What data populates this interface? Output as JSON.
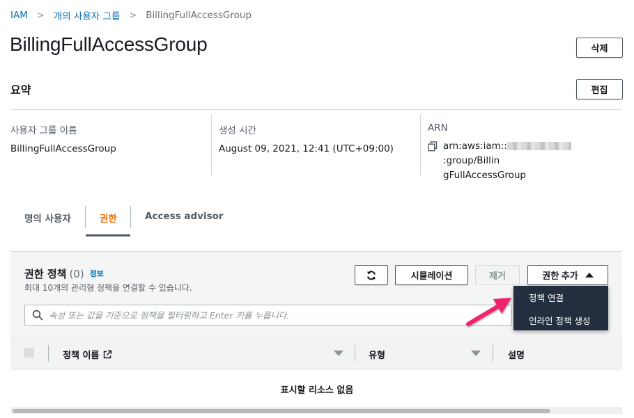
{
  "breadcrumb": {
    "root": "IAM",
    "parent": "개의 사용자 그룹",
    "current": "BillingFullAccessGroup"
  },
  "page": {
    "title": "BillingFullAccessGroup",
    "delete_label": "삭제"
  },
  "summary": {
    "title": "요약",
    "edit_label": "편집",
    "group_name_label": "사용자 그룹 이름",
    "group_name_value": "BillingFullAccessGroup",
    "created_label": "생성 시간",
    "created_value": "August 09, 2021, 12:41 (UTC+09:00)",
    "arn_label": "ARN",
    "arn_prefix": "arn:aws:iam::",
    "arn_suffix": ":group/Billin",
    "arn_line2": "gFullAccessGroup"
  },
  "tabs": [
    {
      "label": "명의 사용자"
    },
    {
      "label": "권한"
    },
    {
      "label": "Access advisor"
    }
  ],
  "permissions": {
    "title": "권한 정책",
    "count": "(0)",
    "info": "정보",
    "description": "최대 10개의 관리형 정책을 연결할 수 있습니다.",
    "simulate_label": "시뮬레이션",
    "remove_label": "제거",
    "add_label": "권한 추가",
    "search_placeholder": "속성 또는 값을 기준으로 정책을 필터링하고 Enter 키를 누릅니다.",
    "menu": [
      {
        "label": "정책 연결"
      },
      {
        "label": "인라인 정책 생성"
      }
    ],
    "columns": [
      {
        "label": "정책 이름"
      },
      {
        "label": "유형"
      },
      {
        "label": "설명"
      }
    ],
    "empty_text": "표시할 리소스 없음"
  },
  "colors": {
    "link": "#0073bb",
    "active_tab": "#ec7211",
    "menu_bg": "#232f3e",
    "annotation_arrow": "#f0246e"
  },
  "icons": {
    "refresh": "refresh-icon",
    "search": "search-icon",
    "copy": "copy-icon",
    "external": "external-link-icon",
    "caret": "caret-up-icon"
  }
}
